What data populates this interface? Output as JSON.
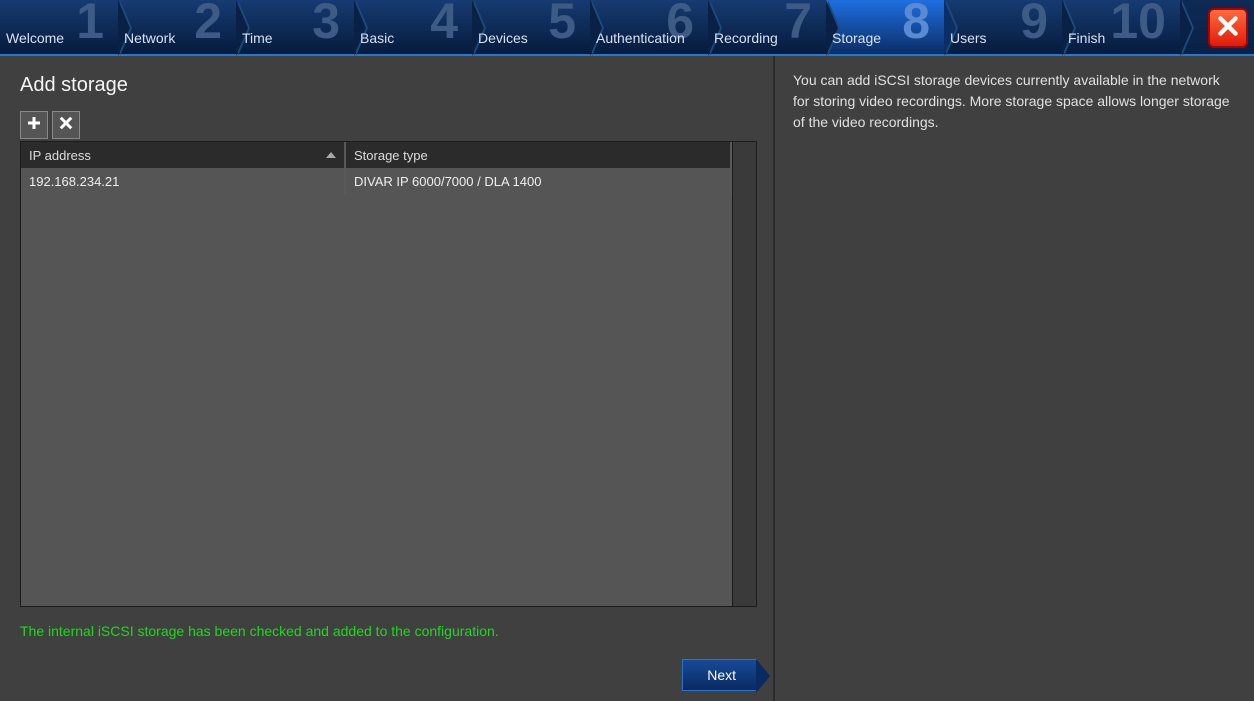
{
  "wizard": {
    "steps": [
      {
        "number": "1",
        "label": "Welcome"
      },
      {
        "number": "2",
        "label": "Network"
      },
      {
        "number": "3",
        "label": "Time"
      },
      {
        "number": "4",
        "label": "Basic"
      },
      {
        "number": "5",
        "label": "Devices"
      },
      {
        "number": "6",
        "label": "Authentication"
      },
      {
        "number": "7",
        "label": "Recording"
      },
      {
        "number": "8",
        "label": "Storage"
      },
      {
        "number": "9",
        "label": "Users"
      },
      {
        "number": "10",
        "label": "Finish"
      }
    ],
    "active_index": 7
  },
  "page": {
    "title": "Add storage",
    "status_message": "The internal iSCSI storage has been checked and added to the configuration.",
    "next_button_label": "Next"
  },
  "toolbar": {
    "add_icon": "plus-icon",
    "remove_icon": "x-icon"
  },
  "table": {
    "columns": {
      "ip": "IP address",
      "type": "Storage type"
    },
    "sort_column": "ip",
    "sort_dir": "asc",
    "rows": [
      {
        "ip": "192.168.234.21",
        "type": "DIVAR IP 6000/7000 / DLA 1400"
      }
    ]
  },
  "help": {
    "text": "You can add iSCSI storage devices currently available in the network for storing video recordings. More storage space allows longer storage of the video recordings."
  }
}
